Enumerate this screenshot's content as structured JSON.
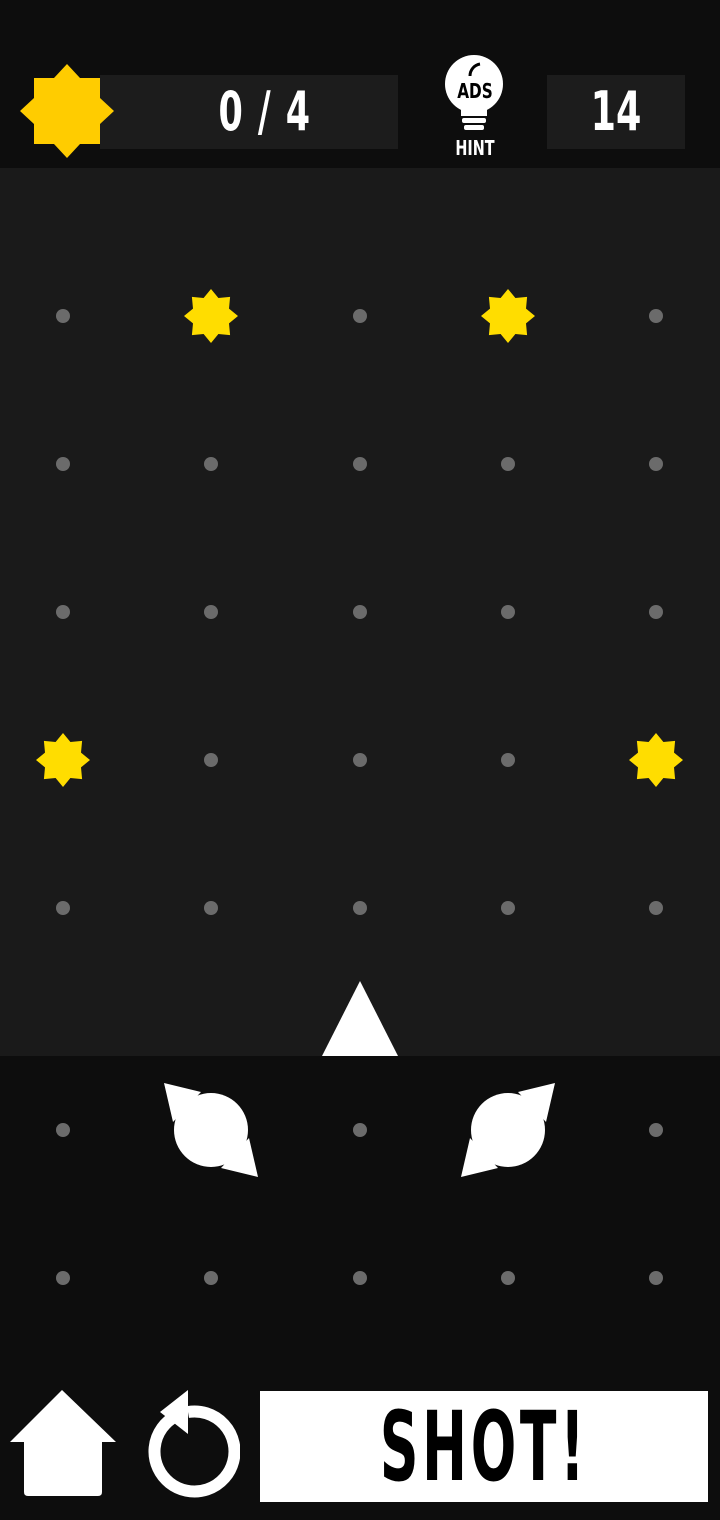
{
  "header": {
    "stars_collected": "0 / 4",
    "hint_badge": "ADS",
    "hint_label": "HINT",
    "shots_left": "14"
  },
  "colors": {
    "background": "#0d0d0d",
    "board": "#1a1a1a",
    "panel": "#1c1c1c",
    "star": "#ffcc00",
    "target_star": "#ffdd00",
    "dot": "#6b6b6b",
    "white": "#ffffff"
  },
  "board": {
    "columns": 5,
    "rows": 7,
    "stars_at": [
      [
        0,
        1
      ],
      [
        0,
        3
      ],
      [
        3,
        0
      ],
      [
        3,
        4
      ]
    ],
    "shooter_cell": [
      5,
      2
    ],
    "deflectors": [
      {
        "cell": [
          5,
          1
        ],
        "orientation": "left"
      },
      {
        "cell": [
          5,
          3
        ],
        "orientation": "right"
      }
    ]
  },
  "controls": {
    "shot_label": "SHOT!",
    "home_icon": "home-icon",
    "restart_icon": "restart-icon"
  }
}
